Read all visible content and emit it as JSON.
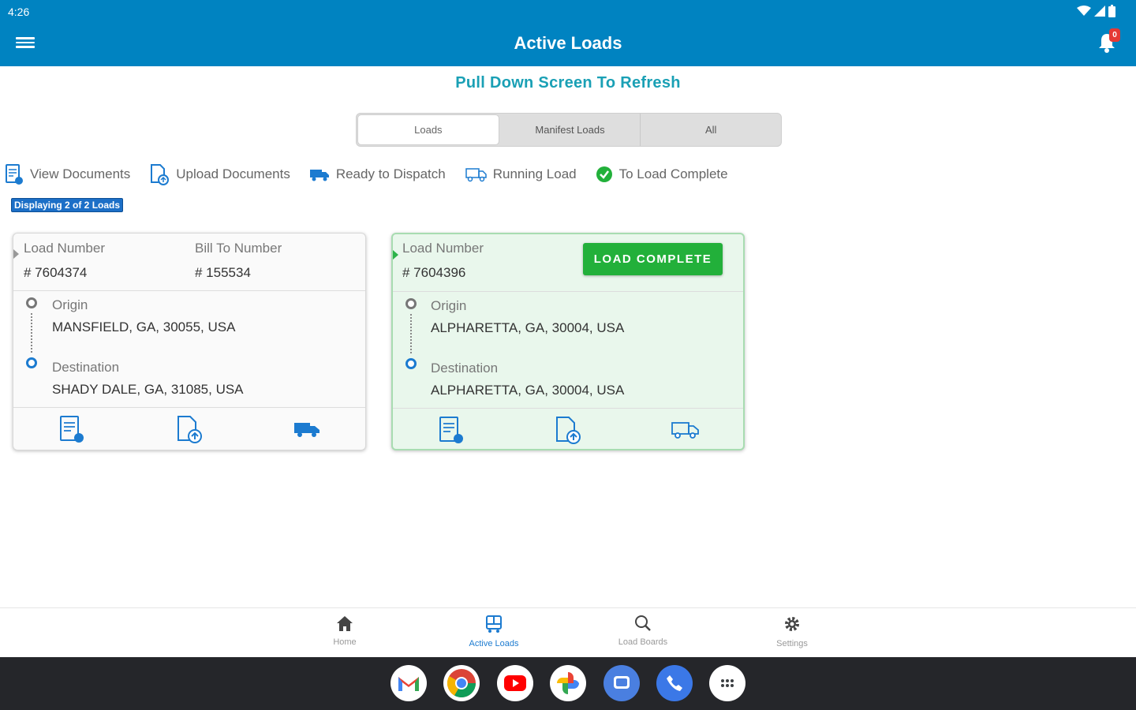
{
  "status_bar": {
    "time": "4:26"
  },
  "app_bar": {
    "title": "Active Loads",
    "notification_count": "0"
  },
  "refresh_hint": "Pull Down Screen To Refresh",
  "tabs": [
    {
      "label": "Loads",
      "active": true
    },
    {
      "label": "Manifest Loads",
      "active": false
    },
    {
      "label": "All",
      "active": false
    }
  ],
  "legend": [
    {
      "label": "View Documents",
      "icon": "view-documents-icon"
    },
    {
      "label": "Upload Documents",
      "icon": "upload-documents-icon"
    },
    {
      "label": "Ready to Dispatch",
      "icon": "truck-icon"
    },
    {
      "label": "Running Load",
      "icon": "running-truck-icon"
    },
    {
      "label": "To Load Complete",
      "icon": "check-circle-icon"
    }
  ],
  "displaying": "Displaying 2 of 2 Loads",
  "loads": [
    {
      "load_number_label": "Load Number",
      "load_number": "# 7604374",
      "bill_to_label": "Bill To Number",
      "bill_to": "# 155534",
      "origin_label": "Origin",
      "origin": "MANSFIELD, GA, 30055, USA",
      "destination_label": "Destination",
      "destination": "SHADY DALE, GA, 31085, USA"
    },
    {
      "load_number_label": "Load Number",
      "load_number": "# 7604396",
      "status_button": "LOAD COMPLETE",
      "origin_label": "Origin",
      "origin": "ALPHARETTA, GA, 30004, USA",
      "destination_label": "Destination",
      "destination": "ALPHARETTA, GA, 30004, USA"
    }
  ],
  "bottom_nav": [
    {
      "label": "Home",
      "icon": "home-icon"
    },
    {
      "label": "Active Loads",
      "icon": "active-loads-icon",
      "active": true
    },
    {
      "label": "Load Boards",
      "icon": "search-icon"
    },
    {
      "label": "Settings",
      "icon": "gear-icon"
    }
  ],
  "colors": {
    "primary": "#0083c1",
    "success": "#22b03a",
    "accent_blue": "#1c7bd0",
    "refresh_text": "#1aa0b5"
  }
}
